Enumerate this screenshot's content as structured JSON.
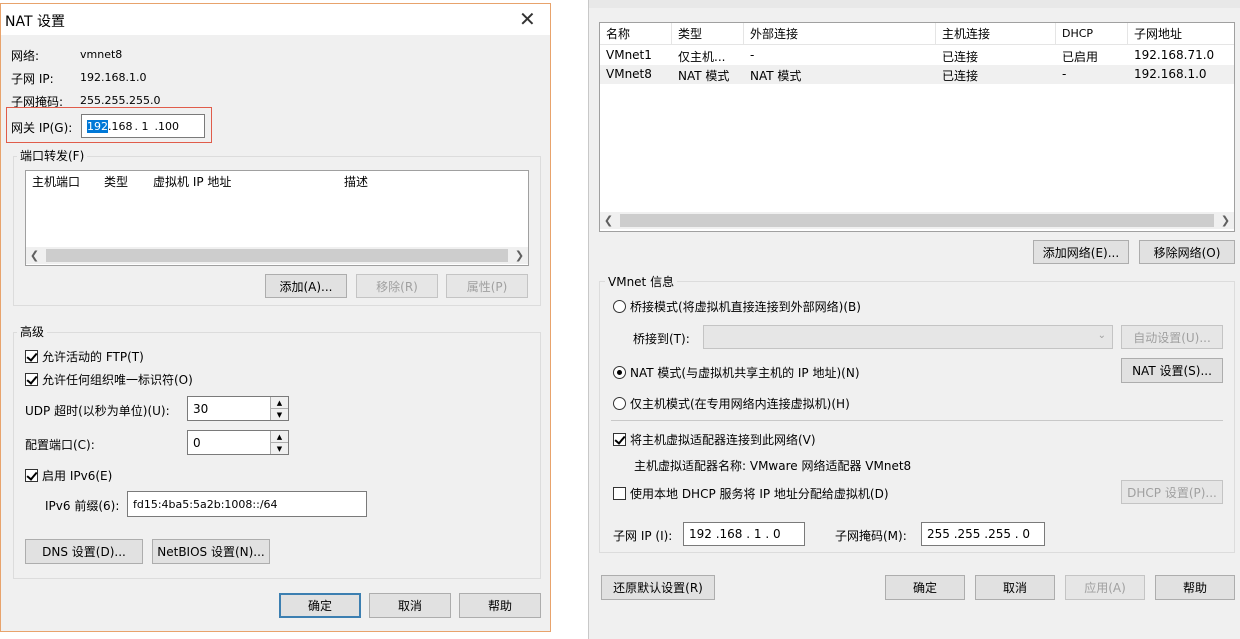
{
  "nat_dialog": {
    "title": "NAT 设置",
    "network_label": "网络:",
    "network_value": "vmnet8",
    "subnet_ip_label": "子网 IP:",
    "subnet_ip_value": "192.168.1.0",
    "subnet_mask_label": "子网掩码:",
    "subnet_mask_value": "255.255.255.0",
    "gateway_label": "网关 IP(G):",
    "gateway_octets": [
      "192",
      ".168",
      ". 1",
      ".100"
    ],
    "port_forwarding": {
      "label": "端口转发(F)",
      "columns": [
        "主机端口",
        "类型",
        "虚拟机 IP 地址",
        "描述"
      ]
    },
    "add_button": "添加(A)...",
    "remove_button": "移除(R)",
    "properties_button": "属性(P)",
    "advanced_label": "高级",
    "allow_ftp": "允许活动的 FTP(T)",
    "allow_uid": "允许任何组织唯一标识符(O)",
    "udp_timeout_label": "UDP 超时(以秒为单位)(U):",
    "udp_timeout_value": "30",
    "config_port_label": "配置端口(C):",
    "config_port_value": "0",
    "enable_ipv6": "启用 IPv6(E)",
    "ipv6_prefix_label": "IPv6 前缀(6):",
    "ipv6_prefix_value": "fd15:4ba5:5a2b:1008::/64",
    "dns_button": "DNS 设置(D)...",
    "netbios_button": "NetBIOS 设置(N)...",
    "ok_button": "确定",
    "cancel_button": "取消",
    "help_button": "帮助"
  },
  "vne": {
    "columns": [
      "名称",
      "类型",
      "外部连接",
      "主机连接",
      "DHCP",
      "子网地址"
    ],
    "rows": [
      [
        "VMnet1",
        "仅主机...",
        "-",
        "已连接",
        "已启用",
        "192.168.71.0"
      ],
      [
        "VMnet8",
        "NAT 模式",
        "NAT 模式",
        "已连接",
        "-",
        "192.168.1.0"
      ]
    ],
    "add_network_button": "添加网络(E)...",
    "remove_network_button": "移除网络(O)",
    "vmnet_info_label": "VMnet 信息",
    "bridged_mode": "桥接模式(将虚拟机直接连接到外部网络)(B)",
    "bridged_to_label": "桥接到(T):",
    "auto_settings_button": "自动设置(U)...",
    "nat_mode": "NAT 模式(与虚拟机共享主机的 IP 地址)(N)",
    "nat_settings_button": "NAT 设置(S)...",
    "host_only_mode": "仅主机模式(在专用网络内连接虚拟机)(H)",
    "connect_adapter": "将主机虚拟适配器连接到此网络(V)",
    "adapter_name_text": "主机虚拟适配器名称: VMware 网络适配器 VMnet8",
    "use_dhcp": "使用本地 DHCP 服务将 IP 地址分配给虚拟机(D)",
    "dhcp_settings_button": "DHCP 设置(P)...",
    "subnet_ip_label": "子网 IP (I):",
    "subnet_ip_value": "192 .168 . 1  . 0",
    "subnet_mask_label": "子网掩码(M):",
    "subnet_mask_value": "255 .255 .255 . 0",
    "restore_defaults_button": "还原默认设置(R)",
    "ok_button": "确定",
    "cancel_button": "取消",
    "apply_button": "应用(A)",
    "help_button": "帮助"
  },
  "colors": {
    "dialog_bg": "#f0f0f0",
    "highlight_box": "#e05c4a",
    "selection": "#0078d7",
    "window_border": "#e8a36c"
  }
}
